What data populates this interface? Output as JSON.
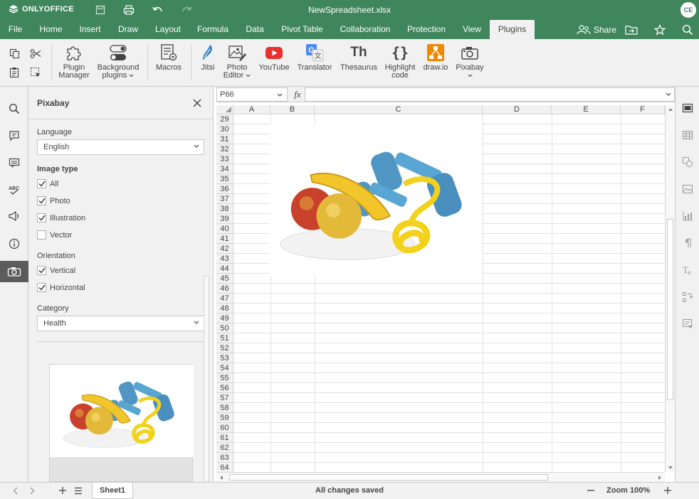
{
  "app": {
    "brand": "ONLYOFFICE",
    "doc_title": "NewSpreadsheet.xlsx",
    "user_initials": "CE",
    "accent": "#40865c"
  },
  "tabs": [
    {
      "label": "File"
    },
    {
      "label": "Home"
    },
    {
      "label": "Insert"
    },
    {
      "label": "Draw"
    },
    {
      "label": "Layout"
    },
    {
      "label": "Formula"
    },
    {
      "label": "Data"
    },
    {
      "label": "Pivot Table"
    },
    {
      "label": "Collaboration"
    },
    {
      "label": "Protection"
    },
    {
      "label": "View"
    },
    {
      "label": "Plugins",
      "active": true
    }
  ],
  "header": {
    "share_label": "Share"
  },
  "toolbar": {
    "plugin_manager": "Plugin Manager",
    "plugin_manager_l1": "Plugin",
    "plugin_manager_l2": "Manager",
    "background_plugins_l1": "Background",
    "background_plugins_l2": "plugins",
    "macros": "Macros",
    "jitsi": "Jitsi",
    "photo_editor_l1": "Photo",
    "photo_editor_l2": "Editor",
    "youtube": "YouTube",
    "translator": "Translator",
    "thesaurus": "Thesaurus",
    "thesaurus_glyph": "Th",
    "highlight_code_l1": "Highlight",
    "highlight_code_l2": "code",
    "highlight_glyph": "{}",
    "drawio": "draw.io",
    "pixabay": "Pixabay"
  },
  "panel": {
    "title": "Pixabay",
    "language_label": "Language",
    "language_value": "English",
    "image_type_label": "Image type",
    "image_types": [
      {
        "label": "All",
        "checked": true
      },
      {
        "label": "Photo",
        "checked": true
      },
      {
        "label": "Illustration",
        "checked": true
      },
      {
        "label": "Vector",
        "checked": false
      }
    ],
    "orientation_label": "Orientation",
    "orientations": [
      {
        "label": "Vertical",
        "checked": true
      },
      {
        "label": "Horizontal",
        "checked": true
      }
    ],
    "category_label": "Category",
    "category_value": "Health"
  },
  "formula_bar": {
    "cell_ref": "P66",
    "fx": "fx",
    "formula": ""
  },
  "grid": {
    "columns": [
      "A",
      "B",
      "C",
      "D",
      "E",
      "F"
    ],
    "rows": [
      "29",
      "30",
      "31",
      "32",
      "33",
      "34",
      "35",
      "36",
      "37",
      "38",
      "39",
      "40",
      "41",
      "42",
      "43",
      "44",
      "45",
      "46",
      "47",
      "48",
      "49",
      "50",
      "51",
      "52",
      "53",
      "54",
      "55",
      "56",
      "57",
      "58",
      "59",
      "60",
      "61",
      "62",
      "63",
      "64"
    ]
  },
  "status": {
    "sheet_name": "Sheet1",
    "save_status": "All changes saved",
    "zoom": "Zoom 100%"
  }
}
